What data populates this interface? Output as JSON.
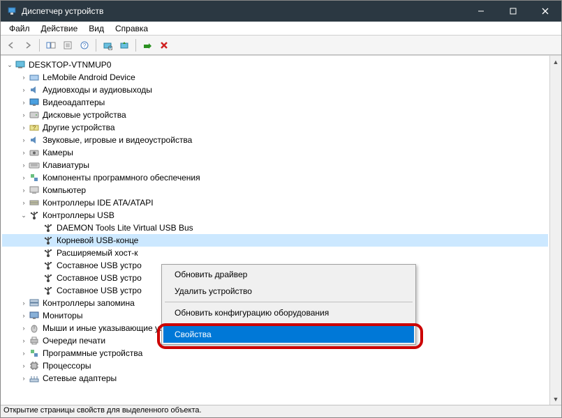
{
  "window": {
    "title": "Диспетчер устройств"
  },
  "menu": {
    "file": "Файл",
    "action": "Действие",
    "view": "Вид",
    "help": "Справка"
  },
  "tree": {
    "root": "DESKTOP-VTNMUP0",
    "categories": [
      {
        "label": "LeMobile Android Device",
        "expanded": false
      },
      {
        "label": "Аудиовходы и аудиовыходы",
        "expanded": false
      },
      {
        "label": "Видеоадаптеры",
        "expanded": false
      },
      {
        "label": "Дисковые устройства",
        "expanded": false
      },
      {
        "label": "Другие устройства",
        "expanded": false
      },
      {
        "label": "Звуковые, игровые и видеоустройства",
        "expanded": false
      },
      {
        "label": "Камеры",
        "expanded": false
      },
      {
        "label": "Клавиатуры",
        "expanded": false
      },
      {
        "label": "Компоненты программного обеспечения",
        "expanded": false
      },
      {
        "label": "Компьютер",
        "expanded": false
      },
      {
        "label": "Контроллеры IDE ATA/ATAPI",
        "expanded": false
      },
      {
        "label": "Контроллеры USB",
        "expanded": true,
        "children": [
          {
            "label": "DAEMON Tools Lite Virtual USB Bus"
          },
          {
            "label": "Корневой USB-конце",
            "selected": true
          },
          {
            "label": "Расширяемый хост-к"
          },
          {
            "label": "Составное USB устро"
          },
          {
            "label": "Составное USB устро"
          },
          {
            "label": "Составное USB устро"
          }
        ]
      },
      {
        "label": "Контроллеры запомина",
        "expanded": false
      },
      {
        "label": "Мониторы",
        "expanded": false
      },
      {
        "label": "Мыши и иные указывающие устройства",
        "expanded": false
      },
      {
        "label": "Очереди печати",
        "expanded": false
      },
      {
        "label": "Программные устройства",
        "expanded": false
      },
      {
        "label": "Процессоры",
        "expanded": false
      },
      {
        "label": "Сетевые адаптеры",
        "expanded": false
      }
    ]
  },
  "contextMenu": {
    "items": [
      {
        "label": "Обновить драйвер"
      },
      {
        "label": "Удалить устройство"
      },
      {
        "sep": true
      },
      {
        "label": "Обновить конфигурацию оборудования"
      },
      {
        "sep": true
      },
      {
        "label": "Свойства",
        "highlighted": true
      }
    ]
  },
  "statusbar": "Открытие страницы свойств для выделенного объекта."
}
